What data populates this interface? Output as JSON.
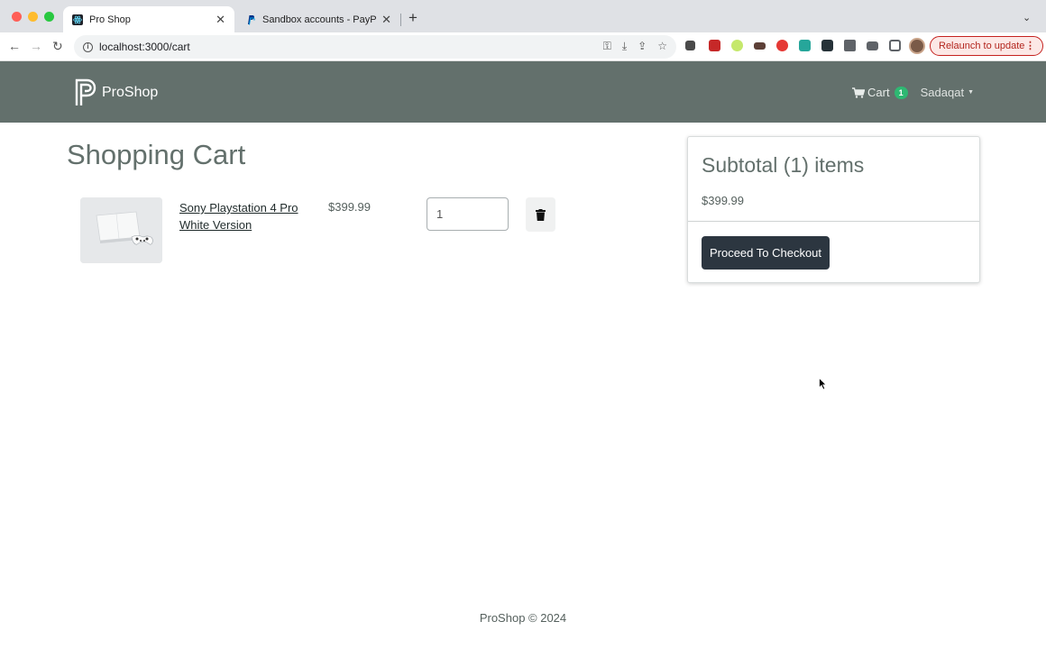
{
  "browser": {
    "tabs": [
      {
        "title": "Pro Shop",
        "active": true
      },
      {
        "title": "Sandbox accounts - PayPal De",
        "active": false
      }
    ],
    "url": "localhost:3000/cart",
    "relaunch_label": "Relaunch to update"
  },
  "header": {
    "brand": "ProShop",
    "cart_label": "Cart",
    "cart_count": "1",
    "user_name": "Sadaqat"
  },
  "main": {
    "title": "Shopping Cart",
    "items": [
      {
        "name": "Sony Playstation 4 Pro White Version",
        "price": "$399.99",
        "quantity": "1"
      }
    ]
  },
  "summary": {
    "title": "Subtotal (1) items",
    "total": "$399.99",
    "checkout_label": "Proceed To Checkout"
  },
  "footer": {
    "text": "ProShop © 2024"
  },
  "colors": {
    "navbar": "#63706c",
    "badge": "#2eb872",
    "checkout_button": "#2c3640"
  }
}
